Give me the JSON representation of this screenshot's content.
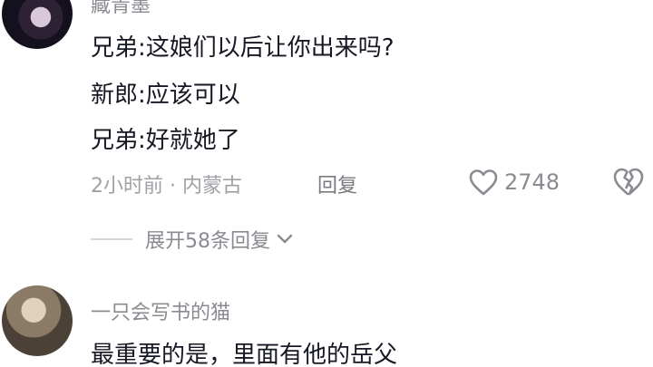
{
  "comment1": {
    "username": "藏青墨",
    "lines": [
      "兄弟:这娘们以后让你出来吗?",
      "新郎:应该可以",
      "兄弟:好就她了"
    ],
    "time_location": "2小时前 · 内蒙古",
    "reply_label": "回复",
    "like_count": "2748",
    "expand_replies": "展开58条回复"
  },
  "comment2": {
    "username": "一只会写书的猫",
    "text": "最重要的是，里面有他的岳父"
  },
  "icons": {
    "like": "heart-icon",
    "dislike": "broken-heart-icon",
    "expand": "chevron-down-icon"
  }
}
